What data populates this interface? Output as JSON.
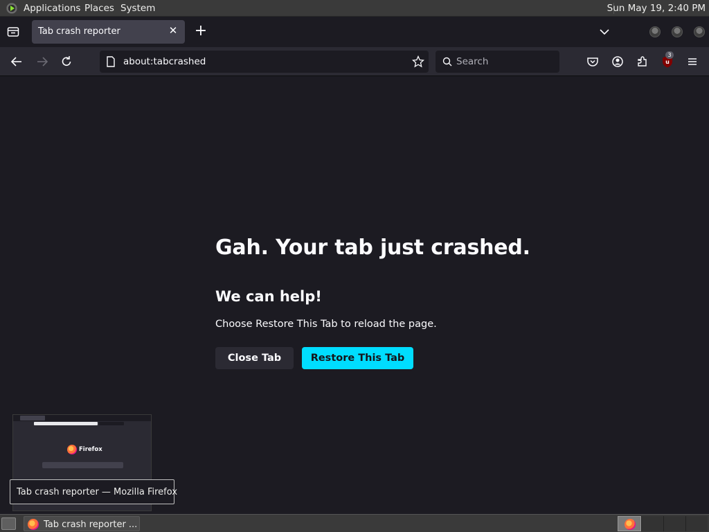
{
  "top_panel": {
    "menus": [
      "Applications",
      "Places",
      "System"
    ],
    "clock": "Sun May 19,  2:40 PM"
  },
  "browser": {
    "tab": {
      "title": "Tab crash reporter",
      "close_icon": "close-icon"
    },
    "new_tab_icon": "plus-icon",
    "url": "about:tabcrashed",
    "search_placeholder": "Search",
    "extension_badge": "3"
  },
  "page": {
    "headline": "Gah. Your tab just crashed.",
    "subheading": "We can help!",
    "description": "Choose Restore This Tab to reload the page.",
    "close_button": "Close Tab",
    "restore_button": "Restore This Tab",
    "accent_color": "#00ddff"
  },
  "preview": {
    "brand": "Firefox"
  },
  "tooltip": "Tab crash reporter — Mozilla Firefox",
  "taskbar": {
    "window_label": "Tab crash reporter ..."
  }
}
